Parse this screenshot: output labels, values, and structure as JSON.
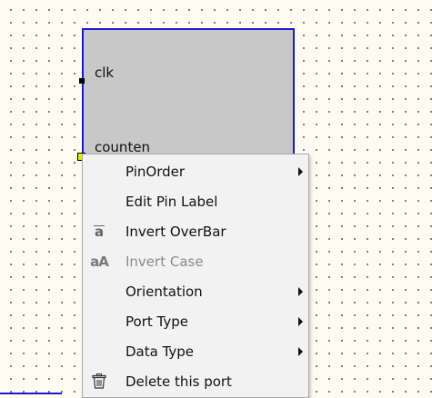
{
  "block": {
    "pins": [
      {
        "label": "clk"
      },
      {
        "label": "counten"
      }
    ]
  },
  "context_menu": {
    "items": [
      {
        "label": "PinOrder",
        "icon": "",
        "submenu": true,
        "enabled": true
      },
      {
        "label": "Edit Pin Label",
        "icon": "",
        "submenu": false,
        "enabled": true
      },
      {
        "label": "Invert OverBar",
        "icon": "overbar-icon",
        "glyph": "a",
        "submenu": false,
        "enabled": true
      },
      {
        "label": "Invert Case",
        "icon": "case-icon",
        "glyph": "aA",
        "submenu": false,
        "enabled": false
      },
      {
        "label": "Orientation",
        "icon": "",
        "submenu": true,
        "enabled": true
      },
      {
        "label": "Port Type",
        "icon": "",
        "submenu": true,
        "enabled": true
      },
      {
        "label": "Data Type",
        "icon": "",
        "submenu": true,
        "enabled": true
      },
      {
        "label": "Delete this port",
        "icon": "trash-icon",
        "submenu": false,
        "enabled": true
      }
    ]
  },
  "colors": {
    "canvas": "#fefcf0",
    "block_fill": "#c8c8c8",
    "block_border": "#1a1ad6",
    "menu_bg": "#f2f2f2",
    "selected_pin": "#e8e800"
  }
}
